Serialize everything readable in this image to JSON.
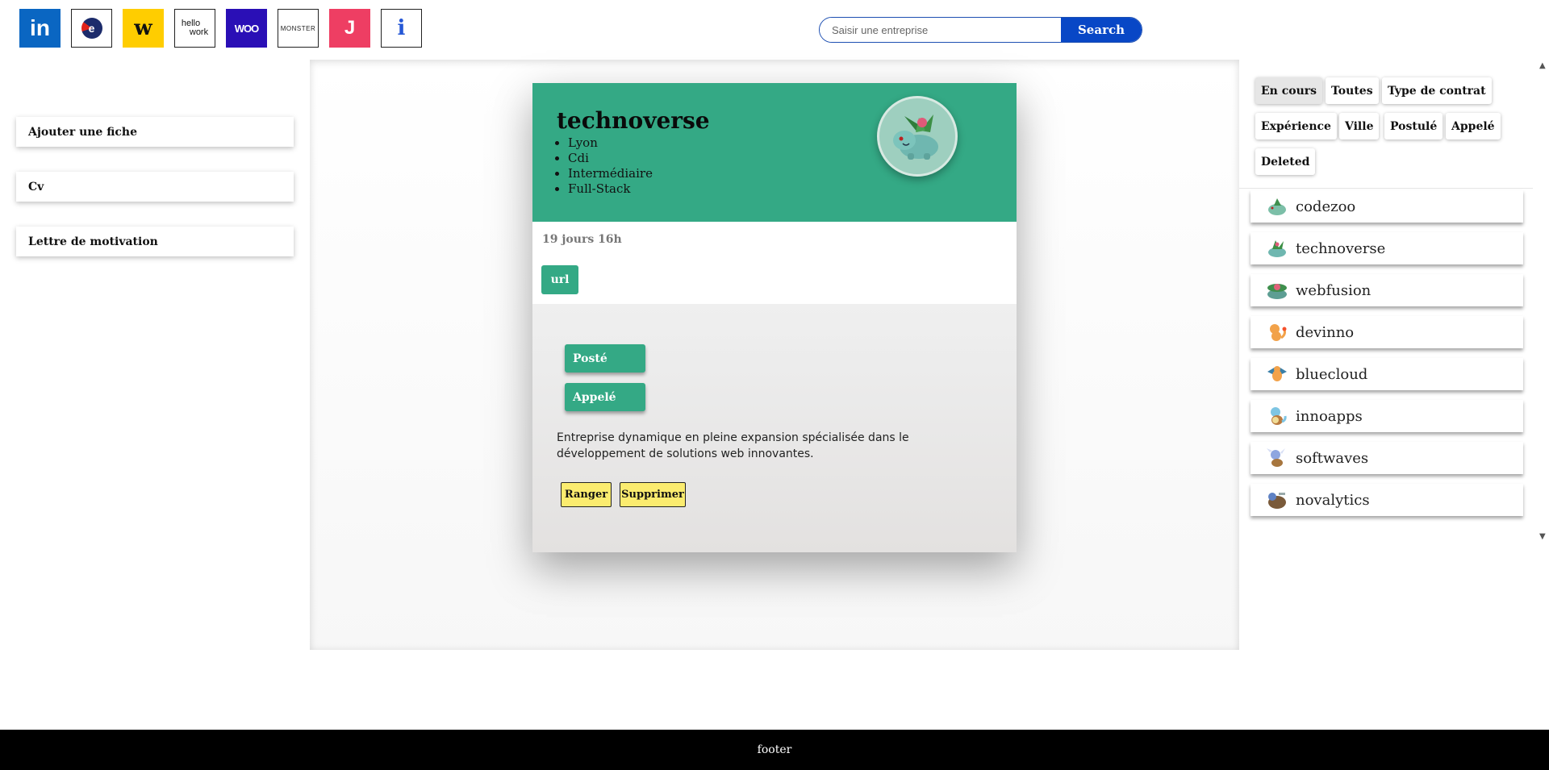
{
  "header": {
    "sites": [
      {
        "name": "linkedin",
        "label": "in"
      },
      {
        "name": "pole-emploi",
        "label": "e"
      },
      {
        "name": "welcome-to-the-jungle",
        "label": "w"
      },
      {
        "name": "hellowork",
        "label_top": "hello",
        "label_bottom": "work"
      },
      {
        "name": "wttj-woo",
        "label": "WOO"
      },
      {
        "name": "monster",
        "label": "MONSTER"
      },
      {
        "name": "jobteaser",
        "label": "J"
      },
      {
        "name": "indeed",
        "label": "i"
      }
    ],
    "search": {
      "placeholder": "Saisir une entreprise",
      "button": "Search"
    }
  },
  "left_menu": {
    "items": [
      "Ajouter une fiche",
      "Cv",
      "Lettre de motivation"
    ]
  },
  "card": {
    "title": "technoverse",
    "tags": [
      "Lyon",
      "Cdi",
      "Intermédiaire",
      "Full-Stack"
    ],
    "elapsed": "19 jours 16h",
    "url_label": "url",
    "status": [
      "Posté",
      "Appelé"
    ],
    "description": "Entreprise dynamique en pleine expansion spécialisée dans le développement de solutions web innovantes.",
    "actions": [
      "Ranger",
      "Supprimer"
    ]
  },
  "filters": {
    "chips": [
      "En cours",
      "Toutes",
      "Type de contrat",
      "Expérience",
      "Ville",
      "Postulé",
      "Appelé",
      "Deleted"
    ],
    "active": "En cours"
  },
  "companies": [
    "codezoo",
    "technoverse",
    "webfusion",
    "devinno",
    "bluecloud",
    "innoapps",
    "softwaves",
    "novalytics"
  ],
  "footer": {
    "text": "footer"
  },
  "colors": {
    "accent": "#34a985",
    "search": "#0847c6",
    "action": "#fbec6f"
  }
}
